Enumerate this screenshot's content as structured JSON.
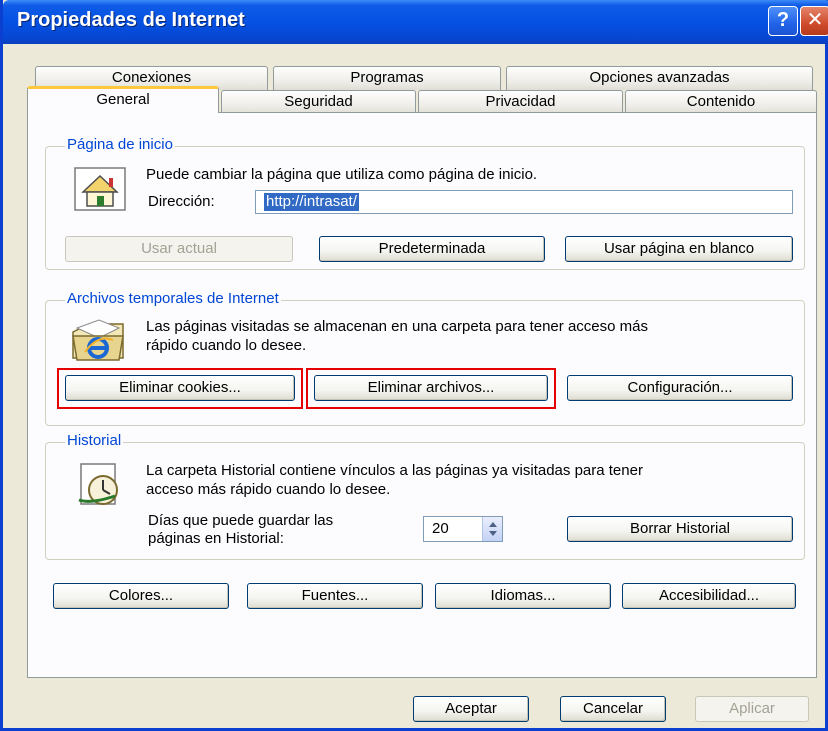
{
  "window": {
    "title": "Propiedades de Internet"
  },
  "titlebar_buttons": {
    "help": "?",
    "close": "✕"
  },
  "tabs": {
    "row_back": [
      "Conexiones",
      "Programas",
      "Opciones avanzadas"
    ],
    "row_front": [
      "General",
      "Seguridad",
      "Privacidad",
      "Contenido"
    ],
    "active": "General"
  },
  "home_page": {
    "group_title": "Página de inicio",
    "description": "Puede cambiar la página que utiliza como página de inicio.",
    "address_label": "Dirección:",
    "address_value": "http://intrasat/",
    "btn_use_current": "Usar actual",
    "btn_default": "Predeterminada",
    "btn_blank": "Usar página en blanco"
  },
  "temp_files": {
    "group_title": "Archivos temporales de Internet",
    "description_line1": "Las páginas visitadas se almacenan en una carpeta para tener acceso más",
    "description_line2": "rápido cuando lo desee.",
    "btn_delete_cookies": "Eliminar cookies...",
    "btn_delete_files": "Eliminar archivos...",
    "btn_settings": "Configuración..."
  },
  "history": {
    "group_title": "Historial",
    "description_line1": "La carpeta Historial contiene vínculos a las páginas ya visitadas para tener",
    "description_line2": "acceso más rápido cuando lo desee.",
    "days_label_line1": "Días que puede guardar las",
    "days_label_line2": "páginas en Historial:",
    "days_value": "20",
    "btn_clear": "Borrar Historial"
  },
  "bottom_buttons": {
    "colors": "Colores...",
    "fonts": "Fuentes...",
    "languages": "Idiomas...",
    "accessibility": "Accesibilidad..."
  },
  "dialog_buttons": {
    "ok": "Aceptar",
    "cancel": "Cancelar",
    "apply": "Aplicar"
  },
  "colors": {
    "titlebar": "#0551e3",
    "group_title": "#0046d5",
    "highlight_box": "#e60000",
    "selection": "#316ac5"
  },
  "icons": {
    "home": "home-page-icon",
    "temp_files": "ie-folder-icon",
    "history": "history-clock-icon",
    "spinner": "spinner-arrows-icon"
  }
}
